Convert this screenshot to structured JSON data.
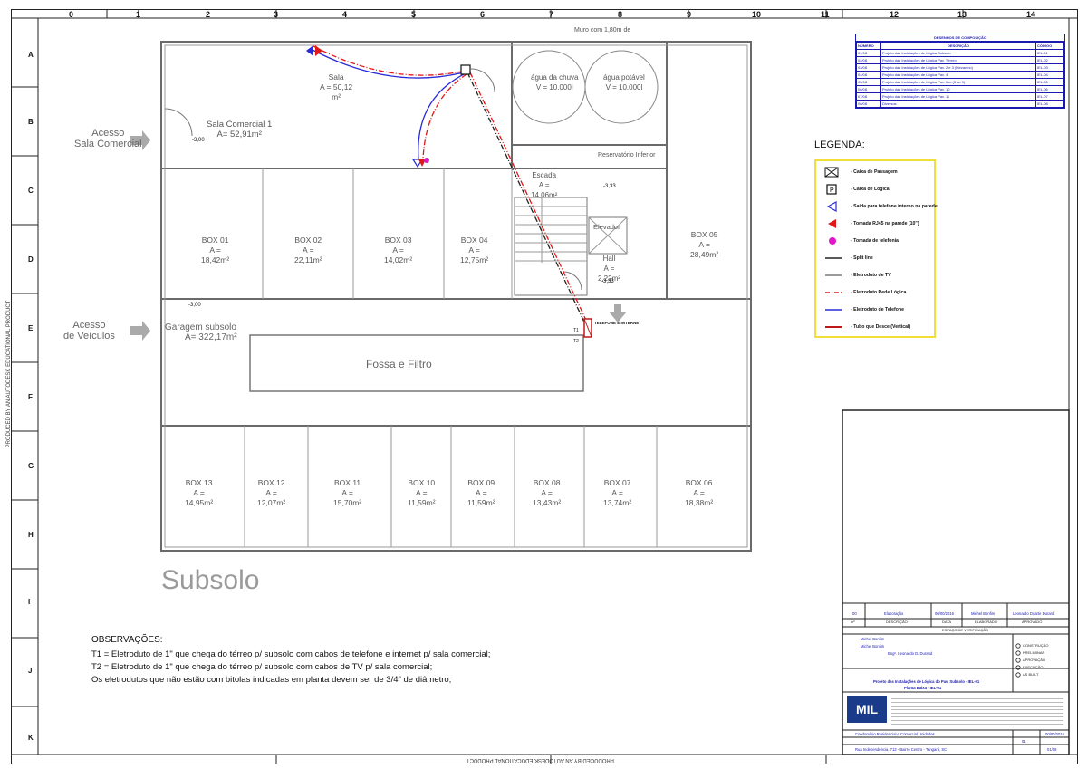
{
  "sheet": {
    "column_numbers": [
      "0",
      "1",
      "2",
      "3",
      "4",
      "5",
      "6",
      "7",
      "8",
      "9",
      "10",
      "11",
      "12",
      "13",
      "14"
    ],
    "row_letters": [
      "A",
      "B",
      "C",
      "D",
      "E",
      "F",
      "G",
      "H",
      "I",
      "J",
      "K"
    ],
    "left_margin_text": "PRODUCED BY AN AUTODESK EDUCATIONAL PRODUCT",
    "bottom_margin_text": "PRODUCED BY AN AUTODESK EDUCATIONAL PRODUCT"
  },
  "plan": {
    "title": "Subsolo",
    "access_labels": {
      "sala_comercial": [
        "Acesso",
        "Sala Comercial"
      ],
      "veiculos": [
        "Acesso",
        "de Veículos"
      ]
    },
    "rooms": {
      "sala": {
        "name": "Sala",
        "area": "A = 50,12",
        "unit": "m²"
      },
      "sala_comercial": {
        "name": "Sala Comercial  1",
        "area": "A= 52,91m²"
      },
      "agua_chuva": {
        "name": "água da chuva",
        "volume": "V = 10.000l"
      },
      "agua_potavel": {
        "name": "água potável",
        "volume": "V = 10.000l"
      },
      "muro": {
        "text": "Muro com 1,80m de"
      },
      "reservatorio": {
        "name": "Reservatório Inferior"
      },
      "escada": {
        "name": "Escada",
        "area": "A =",
        "value": "14,06m²"
      },
      "elevador": {
        "name": "Elevador"
      },
      "hall": {
        "name": "Hall",
        "area": "A =",
        "value": "2,22m²"
      },
      "garagem": {
        "name": "Garagem subsolo",
        "area": "A= 322,17m²"
      },
      "fossa": {
        "name": "Fossa e Filtro"
      }
    },
    "boxes_top": [
      {
        "name": "BOX 01",
        "area": "A =",
        "value": "18,42m²"
      },
      {
        "name": "BOX 02",
        "area": "A =",
        "value": "22,11m²"
      },
      {
        "name": "BOX 03",
        "area": "A =",
        "value": "14,02m²"
      },
      {
        "name": "BOX 04",
        "area": "A =",
        "value": "12,75m²"
      }
    ],
    "box05": {
      "name": "BOX 05",
      "area": "A =",
      "value": "28,49m²"
    },
    "boxes_bottom": [
      {
        "name": "BOX 13",
        "area": "A =",
        "value": "14,95m²"
      },
      {
        "name": "BOX 12",
        "area": "A =",
        "value": "12,07m²"
      },
      {
        "name": "BOX 11",
        "area": "A =",
        "value": "15,70m²"
      },
      {
        "name": "BOX 10",
        "area": "A =",
        "value": "11,59m²"
      },
      {
        "name": "BOX 09",
        "area": "A =",
        "value": "11,59m²"
      },
      {
        "name": "BOX 08",
        "area": "A =",
        "value": "13,43m²"
      },
      {
        "name": "BOX 07",
        "area": "A =",
        "value": "13,74m²"
      },
      {
        "name": "BOX 06",
        "area": "A =",
        "value": "18,38m²"
      }
    ],
    "levels": {
      "sala": "-3,00",
      "garagem": "-3,00",
      "escada": "-3,33",
      "hall": "-3,33"
    },
    "conduit_tag": "TELEFONE E INTERNET",
    "conduit_codes": [
      "T1",
      "T2"
    ]
  },
  "index_table": {
    "title": "DESENHOS DE COMPOSIÇÃO",
    "headers": [
      "NÚMERO",
      "DESCRIÇÃO",
      "CÓDIGO"
    ],
    "rows": [
      [
        "01/08",
        "Projeto das Instalações de Lógica Subsolo",
        "IEL-01"
      ],
      [
        "02/08",
        "Projeto das Instalações de Lógica Pav. Térreo",
        "IEL-02"
      ],
      [
        "03/08",
        "Projeto das Instalações de Lógica Pav. 2 e 3 (Mezanino)",
        "IEL-03"
      ],
      [
        "04/08",
        "Projeto das Instalações de Lógica Pav. 4",
        "IEL-04"
      ],
      [
        "05/08",
        "Projeto das Instalações de Lógica Pav. tipo (5 ao 9)",
        "IEL-05"
      ],
      [
        "06/08",
        "Projeto das Instalações de Lógica Pav. 10",
        "IEL-06"
      ],
      [
        "07/08",
        "Projeto das Instalações de Lógica Pav. 11",
        "IEL-07"
      ],
      [
        "08/08",
        "Diversos",
        "IEL-08"
      ]
    ]
  },
  "legend": {
    "title": "LEGENDA:",
    "items": [
      "- Caixa de Passagem",
      "- Caixa de Lógica",
      "- Saída para telefone interno na parede",
      "- Tomada RJ45 na parede (10\")",
      "- Tomada de telefonia",
      "- Split line",
      "- Eletroduto de TV",
      "- Eletroduto Rede Lógica",
      "- Eletroduto de Telefone",
      "- Tubo que Desce (Vertical)"
    ],
    "colors": {
      "caixa": "#111111",
      "telefone_interno": "#2a2ad8",
      "rj45": "#e01818",
      "telefonia": "#e018c8",
      "split": "#222222",
      "tv": "#9a9a9a",
      "logica": "#e01818",
      "telefone": "#2a2ad8",
      "tubo": "#c01818"
    }
  },
  "observations": {
    "title": "OBSERVAÇÕES:",
    "lines": [
      "T1 = Eletroduto de 1\" que chega do térreo p/ subsolo com cabos de telefone e internet p/ sala comercial;",
      "T2 = Eletroduto de 1\" que chega do térreo p/ subsolo com cabos de TV p/ sala comercial;",
      "Os eletrodutos que não estão com bitolas indicadas em planta devem ser de 3/4\" de diâmetro;"
    ]
  },
  "title_block": {
    "revision": {
      "no": "00",
      "desc": "Elaboração",
      "date": "00/00/2016",
      "by": "Michel Bonfim",
      "approved": "Leonardo Duarte Durand"
    },
    "revision_labels": {
      "no": "nº",
      "desc": "DESCRIÇÃO",
      "date": "DATA",
      "by": "ELABORADO",
      "approved": "APROVADO"
    },
    "revision_header": "ESPAÇO DE VERIFICAÇÃO",
    "fields": [
      "Michel Bonfim",
      "Michel Bonfim",
      "Engº. Leonardo D. Durand",
      "Projeto das Instalações de Lógica do Pav. Subsolo - IEL-01",
      "Planta Baixa - IEL-01"
    ],
    "checklist": [
      "CONSTRUÇÃO",
      "PRELIMINAR",
      "APROVAÇÃO",
      "EXECUÇÃO",
      "AS BUILT"
    ],
    "logo": "MIL",
    "client": [
      "Condomínio Residencial e Comercial Unidades",
      "Rua Independência, 713 - Bairro Centro - Tangará, SC"
    ],
    "sheet_no": "01",
    "sheet_total": "01/08",
    "date": "00/00/2016"
  }
}
